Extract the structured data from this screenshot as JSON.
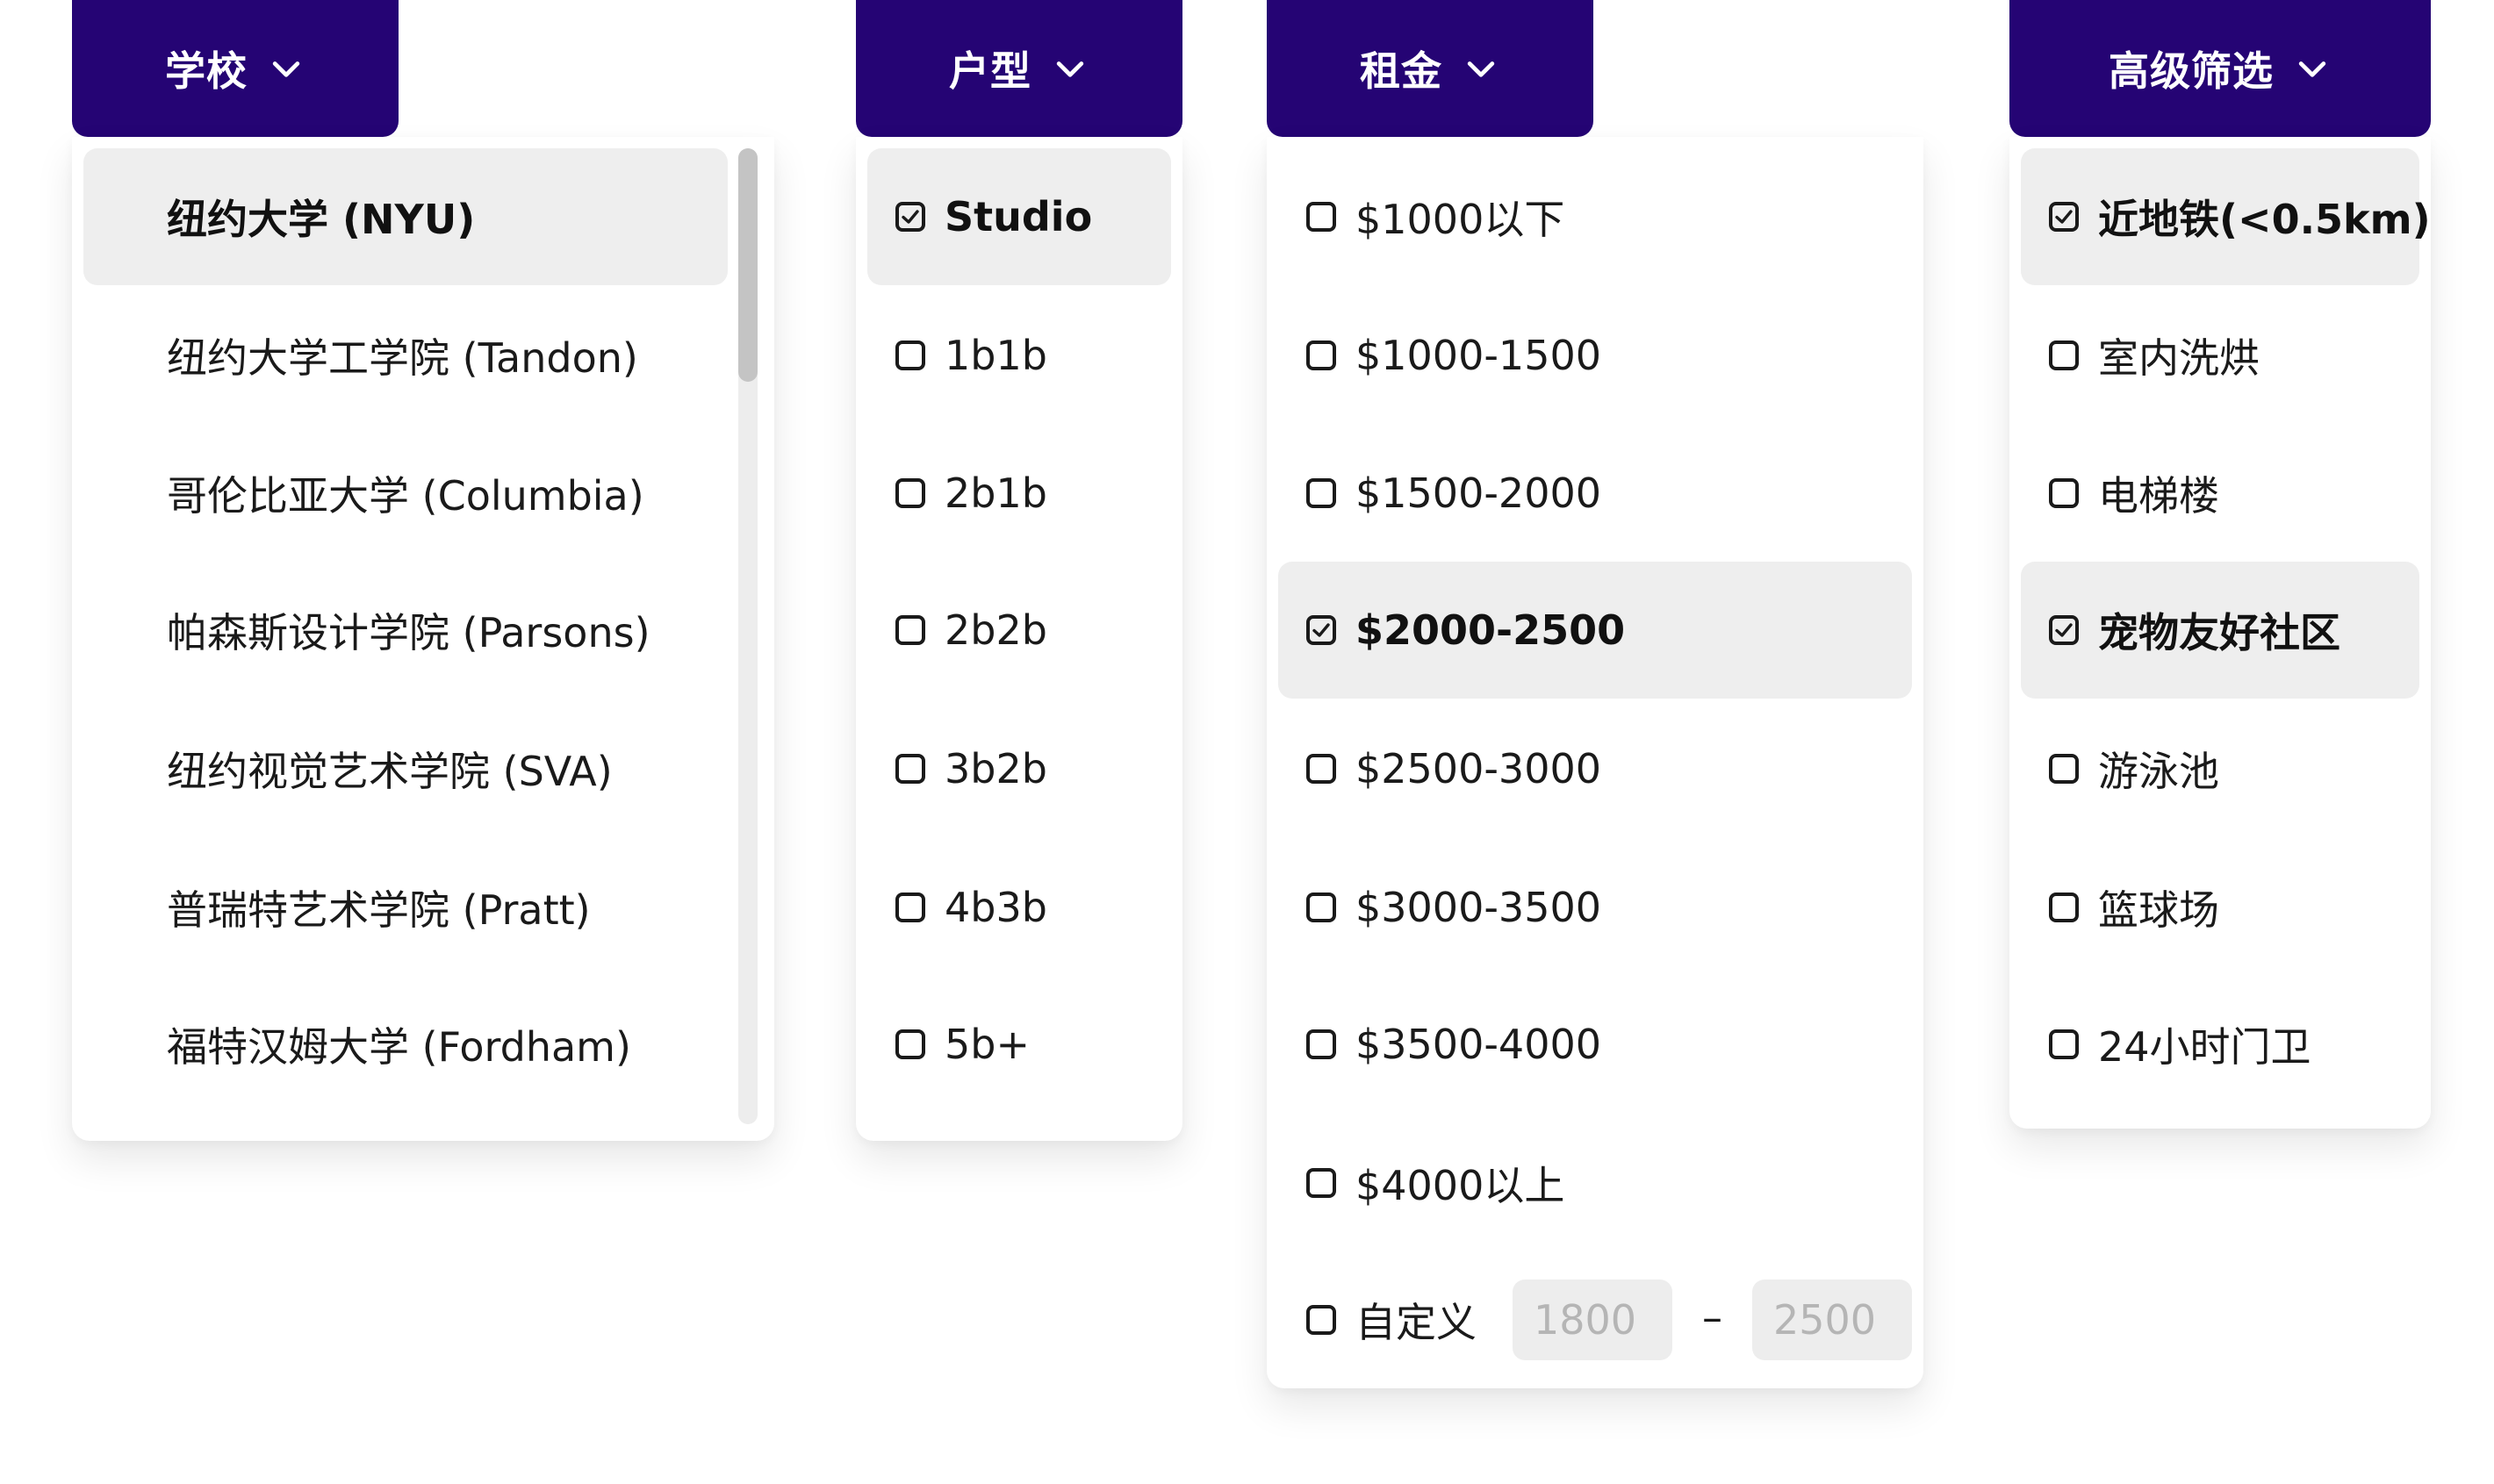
{
  "school": {
    "button_label": "学校",
    "options": [
      "纽约大学 (NYU)",
      "纽约大学工学院 (Tandon)",
      "哥伦比亚大学 (Columbia)",
      "帕森斯设计学院 (Parsons)",
      "纽约视觉艺术学院 (SVA)",
      "普瑞特艺术学院 (Pratt)",
      "福特汉姆大学 (Fordham)"
    ],
    "selected_index": 0
  },
  "unit_type": {
    "button_label": "户型",
    "options": [
      "Studio",
      "1b1b",
      "2b1b",
      "2b2b",
      "3b2b",
      "4b3b",
      "5b+"
    ],
    "checked": [
      true,
      false,
      false,
      false,
      false,
      false,
      false
    ]
  },
  "rent": {
    "button_label": "租金",
    "options": [
      "$1000以下",
      "$1000-1500",
      "$1500-2000",
      "$2000-2500",
      "$2500-3000",
      "$3000-3500",
      "$3500-4000",
      "$4000以上"
    ],
    "checked": [
      false,
      false,
      false,
      true,
      false,
      false,
      false,
      false
    ],
    "custom": {
      "label": "自定义",
      "checked": false,
      "min_placeholder": "1800",
      "max_placeholder": "2500",
      "separator": "–"
    }
  },
  "advanced": {
    "button_label": "高级筛选",
    "options": [
      "近地铁(<0.5km)",
      "室内洗烘",
      "电梯楼",
      "宠物友好社区",
      "游泳池",
      "篮球场",
      "24小时门卫"
    ],
    "checked": [
      true,
      false,
      false,
      true,
      false,
      false,
      false
    ]
  },
  "colors": {
    "button_bg": "#250474",
    "selected_row_bg": "#eeeeee",
    "input_bg": "#ededed"
  },
  "icons": {
    "dropdown": "chevron-down-icon",
    "checkbox": "checkbox-icon"
  }
}
